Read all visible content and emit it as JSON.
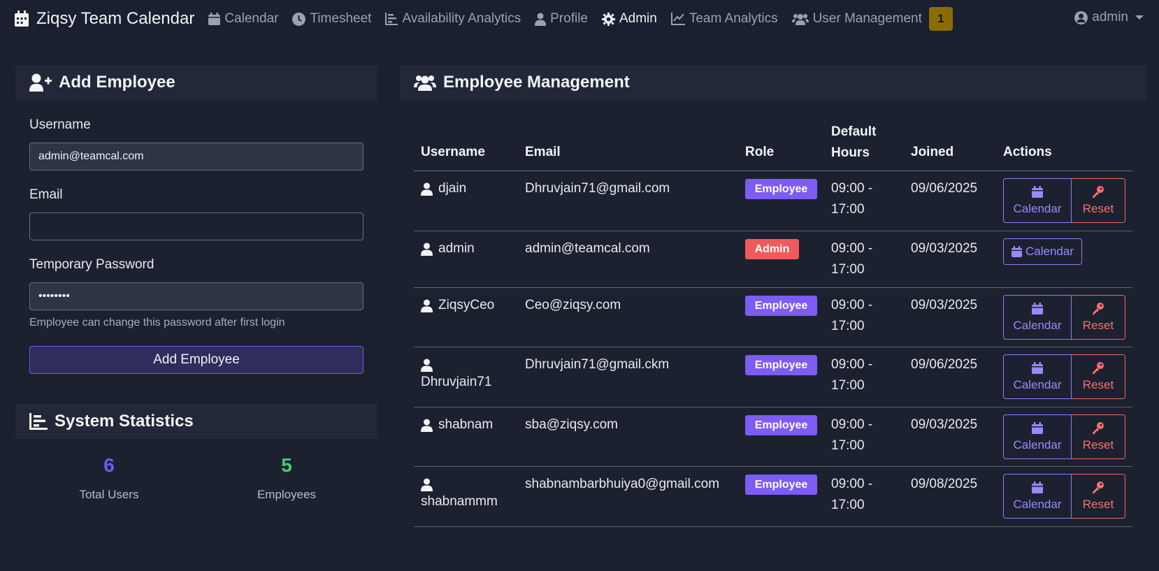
{
  "nav": {
    "brand": "Ziqsy Team Calendar",
    "items": [
      "Calendar",
      "Timesheet",
      "Availability Analytics",
      "Profile",
      "Admin",
      "Team Analytics",
      "User Management"
    ],
    "notification_count": "1",
    "user": "admin"
  },
  "add_employee": {
    "title": "Add Employee",
    "username_label": "Username",
    "username_value": "admin@teamcal.com",
    "email_label": "Email",
    "email_value": "",
    "password_label": "Temporary Password",
    "password_value": "••••••••",
    "help_text": "Employee can change this password after first login",
    "submit_label": "Add Employee"
  },
  "stats": {
    "title": "System Statistics",
    "total_users": "6",
    "total_users_label": "Total Users",
    "employees": "5",
    "employees_label": "Employees",
    "colors": {
      "total": "#6c5cf0",
      "employees": "#4cc870"
    }
  },
  "employees": {
    "title": "Employee Management",
    "columns": [
      "Username",
      "Email",
      "Role",
      "Default Hours",
      "Joined",
      "Actions"
    ],
    "calendar_label": "Calendar",
    "reset_label": "Reset",
    "rows": [
      {
        "username": "djain",
        "email": "Dhruvjain71@gmail.com",
        "role": "Employee",
        "hours": "09:00 - 17:00",
        "joined": "09/06/2025"
      },
      {
        "username": "admin",
        "email": "admin@teamcal.com",
        "role": "Admin",
        "hours": "09:00 - 17:00",
        "joined": "09/03/2025"
      },
      {
        "username": "ZiqsyCeo",
        "email": "Ceo@ziqsy.com",
        "role": "Employee",
        "hours": "09:00 - 17:00",
        "joined": "09/03/2025"
      },
      {
        "username": "Dhruvjain71",
        "email": "Dhruvjain71@gmail.ckm",
        "role": "Employee",
        "hours": "09:00 - 17:00",
        "joined": "09/06/2025"
      },
      {
        "username": "shabnam",
        "email": "sba@ziqsy.com",
        "role": "Employee",
        "hours": "09:00 - 17:00",
        "joined": "09/03/2025"
      },
      {
        "username": "shabnammm",
        "email": "shabnambarbhuiya0@gmail.com",
        "role": "Employee",
        "hours": "09:00 - 17:00",
        "joined": "09/08/2025"
      }
    ]
  }
}
